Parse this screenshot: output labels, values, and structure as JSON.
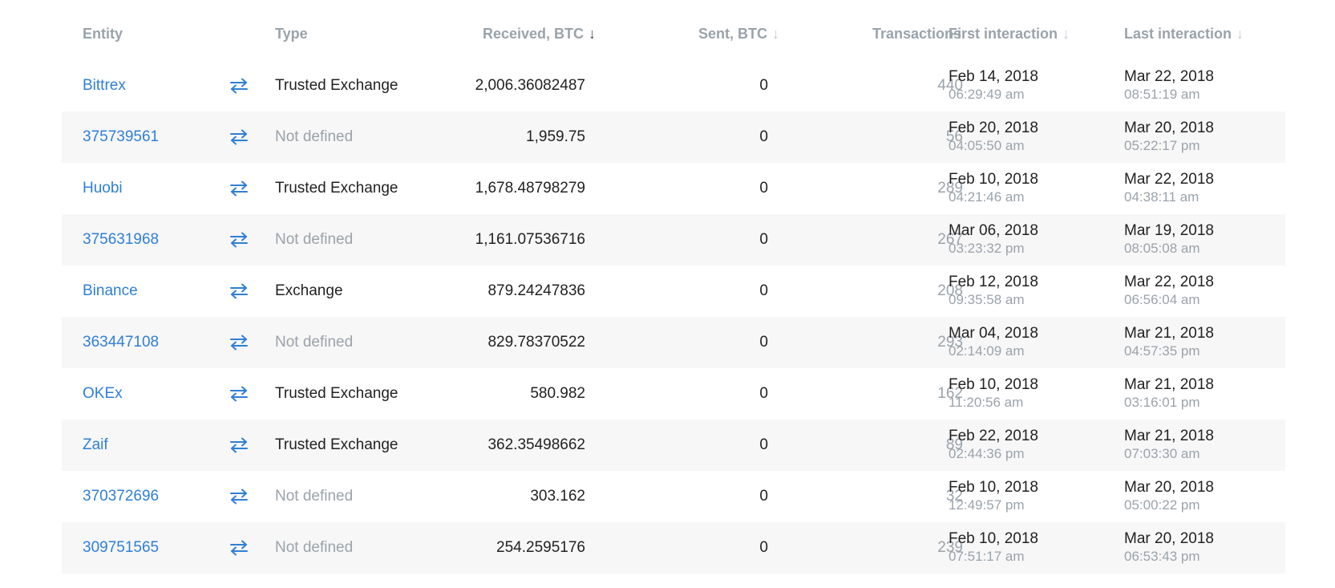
{
  "headers": {
    "entity": "Entity",
    "type": "Type",
    "received": "Received, BTC",
    "sent": "Sent, BTC",
    "transactions": "Transactions",
    "first": "First interaction",
    "last": "Last interaction",
    "arrow": "↓"
  },
  "accent_color": "#2f7fd6",
  "row_icon": "swap-arrows-icon",
  "rows": [
    {
      "entity": "Bittrex",
      "type": "Trusted Exchange",
      "defined": true,
      "received": "2,006.36082487",
      "sent": "0",
      "transactions": "440",
      "first_date": "Feb 14, 2018",
      "first_time": "06:29:49 am",
      "last_date": "Mar 22, 2018",
      "last_time": "08:51:19 am"
    },
    {
      "entity": "375739561",
      "type": "Not defined",
      "defined": false,
      "received": "1,959.75",
      "sent": "0",
      "transactions": "56",
      "first_date": "Feb 20, 2018",
      "first_time": "04:05:50 am",
      "last_date": "Mar 20, 2018",
      "last_time": "05:22:17 pm"
    },
    {
      "entity": "Huobi",
      "type": "Trusted Exchange",
      "defined": true,
      "received": "1,678.48798279",
      "sent": "0",
      "transactions": "289",
      "first_date": "Feb 10, 2018",
      "first_time": "04:21:46 am",
      "last_date": "Mar 22, 2018",
      "last_time": "04:38:11 am"
    },
    {
      "entity": "375631968",
      "type": "Not defined",
      "defined": false,
      "received": "1,161.07536716",
      "sent": "0",
      "transactions": "267",
      "first_date": "Mar 06, 2018",
      "first_time": "03:23:32 pm",
      "last_date": "Mar 19, 2018",
      "last_time": "08:05:08 am"
    },
    {
      "entity": "Binance",
      "type": "Exchange",
      "defined": true,
      "received": "879.24247836",
      "sent": "0",
      "transactions": "208",
      "first_date": "Feb 12, 2018",
      "first_time": "09:35:58 am",
      "last_date": "Mar 22, 2018",
      "last_time": "06:56:04 am"
    },
    {
      "entity": "363447108",
      "type": "Not defined",
      "defined": false,
      "received": "829.78370522",
      "sent": "0",
      "transactions": "293",
      "first_date": "Mar 04, 2018",
      "first_time": "02:14:09 am",
      "last_date": "Mar 21, 2018",
      "last_time": "04:57:35 pm"
    },
    {
      "entity": "OKEx",
      "type": "Trusted Exchange",
      "defined": true,
      "received": "580.982",
      "sent": "0",
      "transactions": "162",
      "first_date": "Feb 10, 2018",
      "first_time": "11:20:56 am",
      "last_date": "Mar 21, 2018",
      "last_time": "03:16:01 pm"
    },
    {
      "entity": "Zaif",
      "type": "Trusted Exchange",
      "defined": true,
      "received": "362.35498662",
      "sent": "0",
      "transactions": "89",
      "first_date": "Feb 22, 2018",
      "first_time": "02:44:36 pm",
      "last_date": "Mar 21, 2018",
      "last_time": "07:03:30 am"
    },
    {
      "entity": "370372696",
      "type": "Not defined",
      "defined": false,
      "received": "303.162",
      "sent": "0",
      "transactions": "32",
      "first_date": "Feb 10, 2018",
      "first_time": "12:49:57 pm",
      "last_date": "Mar 20, 2018",
      "last_time": "05:00:22 pm"
    },
    {
      "entity": "309751565",
      "type": "Not defined",
      "defined": false,
      "received": "254.2595176",
      "sent": "0",
      "transactions": "239",
      "first_date": "Feb 10, 2018",
      "first_time": "07:51:17 am",
      "last_date": "Mar 20, 2018",
      "last_time": "06:53:43 pm"
    }
  ]
}
